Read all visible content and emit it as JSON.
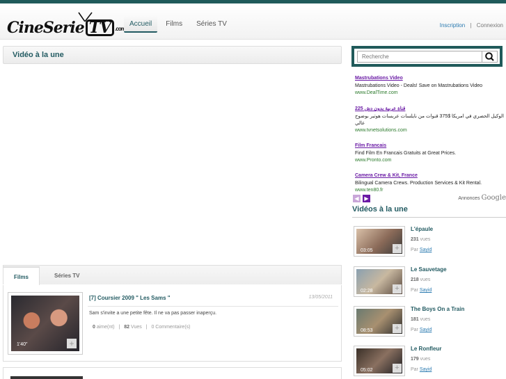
{
  "header": {
    "logo_text": "CineSerieTV",
    "logo_suffix": ".com",
    "nav": [
      {
        "label": "Accueil",
        "active": true
      },
      {
        "label": "Films",
        "active": false
      },
      {
        "label": "Séries TV",
        "active": false
      }
    ],
    "inscription": "Inscription",
    "separator": "|",
    "connexion": "Connexion"
  },
  "featured": {
    "title": "Vidéo à la une"
  },
  "tabs": [
    {
      "label": "Films",
      "active": true
    },
    {
      "label": "Séries TV",
      "active": false
    }
  ],
  "video_list": [
    {
      "title": "[7] Coursier 2009 \" Les Sams \"",
      "date": "13/05/2011",
      "duration": "1'40\"",
      "description": "Sam s'invite a une petite fête. Il ne va pas passer inaperçu.",
      "likes_count": "0",
      "likes_label": "aime(nt)",
      "views_count": "82",
      "views_label": "Vues",
      "comments": "0 Commentaire(s)"
    }
  ],
  "search": {
    "placeholder": "Recherche"
  },
  "ads": [
    {
      "title": "Mastrubations Video",
      "desc": "Mastrubations Video - Deals! Save on Mastrubations Video",
      "url": "www.DealTime.com"
    },
    {
      "title": "قناة عربية بدون دش 225",
      "desc": "الوكيل الحصري في امريكا $375 قنوات من نايلسات عربسات هوتبر بوضوح عالي",
      "url": "www.tvnetsolutions.com"
    },
    {
      "title": "Film Francais",
      "desc": "Find Film En Francais Gratuits at Great Prices.",
      "url": "www.Pronto.com"
    },
    {
      "title": "Camera Crew & Kit, France",
      "desc": "Bilingual Camera Crews. Production Services & Kit Rental.",
      "url": "www.ten80.fr"
    }
  ],
  "ads_footer": {
    "label": "Annonces",
    "brand": "Google"
  },
  "sidebar": {
    "title": "Vidéos à la une",
    "by_label": "Par",
    "views_label": "vues",
    "items": [
      {
        "title": "L'épaule",
        "views": "231",
        "duration": "03:05",
        "author": "Sayid"
      },
      {
        "title": "Le Sauvetage",
        "views": "218",
        "duration": "02:28",
        "author": "Sayid"
      },
      {
        "title": "The Boys On a Train",
        "views": "181",
        "duration": "08:53",
        "author": "Sayid"
      },
      {
        "title": "Le Ronfleur",
        "views": "179",
        "duration": "05:02",
        "author": "Sayid"
      }
    ]
  }
}
